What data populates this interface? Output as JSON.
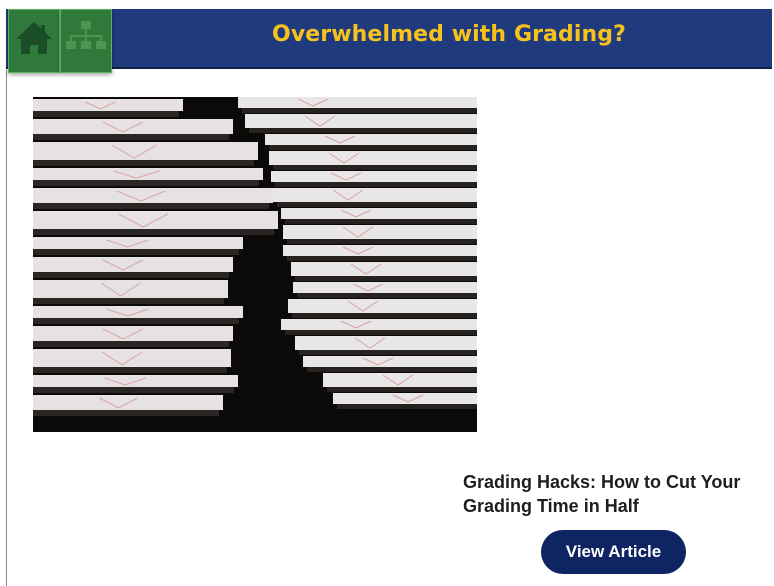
{
  "header": {
    "title": "Overwhelmed with Grading?"
  },
  "nav": {
    "home_icon": "home-icon",
    "sitemap_icon": "sitemap-icon"
  },
  "article": {
    "title": "Grading Hacks: How to Cut Your Grading Time in Half",
    "button_label": "View Article"
  },
  "colors": {
    "header_bg": "#1f3a7d",
    "title_text": "#f6c21b",
    "nav_button": "#2f7a3b",
    "view_button": "#0f2463"
  }
}
